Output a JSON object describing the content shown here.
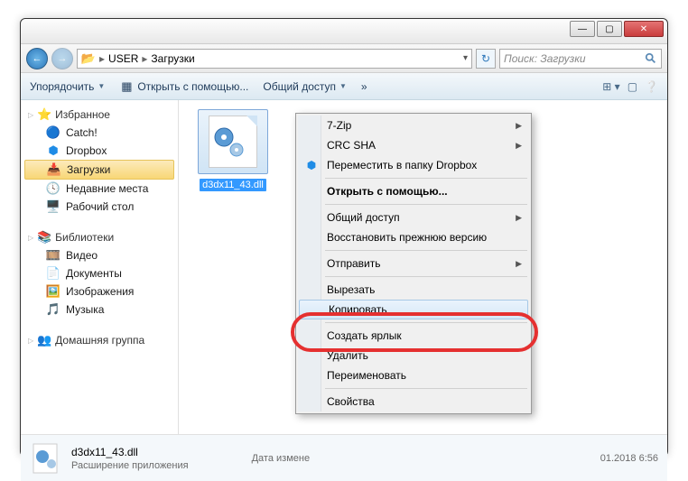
{
  "window": {
    "min": "—",
    "max": "▢",
    "close": "✕"
  },
  "nav": {
    "back": "←",
    "forward": "→",
    "path_seg1": "USER",
    "path_seg2": "Загрузки",
    "refresh": "↻",
    "search_placeholder": "Поиск: Загрузки"
  },
  "toolbar": {
    "organize": "Упорядочить",
    "open_with": "Открыть с помощью...",
    "share": "Общий доступ",
    "more": "»"
  },
  "sidebar": {
    "favorites": {
      "header": "Избранное",
      "items": [
        "Catch!",
        "Dropbox",
        "Загрузки",
        "Недавние места",
        "Рабочий стол"
      ]
    },
    "libraries": {
      "header": "Библиотеки",
      "items": [
        "Видео",
        "Документы",
        "Изображения",
        "Музыка"
      ]
    },
    "homegroup": {
      "header": "Домашняя группа"
    }
  },
  "file": {
    "name": "d3dx11_43.dll"
  },
  "context": {
    "sevenzip": "7-Zip",
    "crcsha": "CRC SHA",
    "dropbox_move": "Переместить в папку Dropbox",
    "open_with": "Открыть с помощью...",
    "share": "Общий доступ",
    "restore": "Восстановить прежнюю версию",
    "send_to": "Отправить",
    "cut": "Вырезать",
    "copy": "Копировать",
    "shortcut": "Создать ярлык",
    "delete": "Удалить",
    "rename": "Переименовать",
    "properties": "Свойства"
  },
  "status": {
    "filename": "d3dx11_43.dll",
    "type": "Расширение приложения",
    "date_label": "Дата измене",
    "date_value": "01.2018 6:56"
  }
}
